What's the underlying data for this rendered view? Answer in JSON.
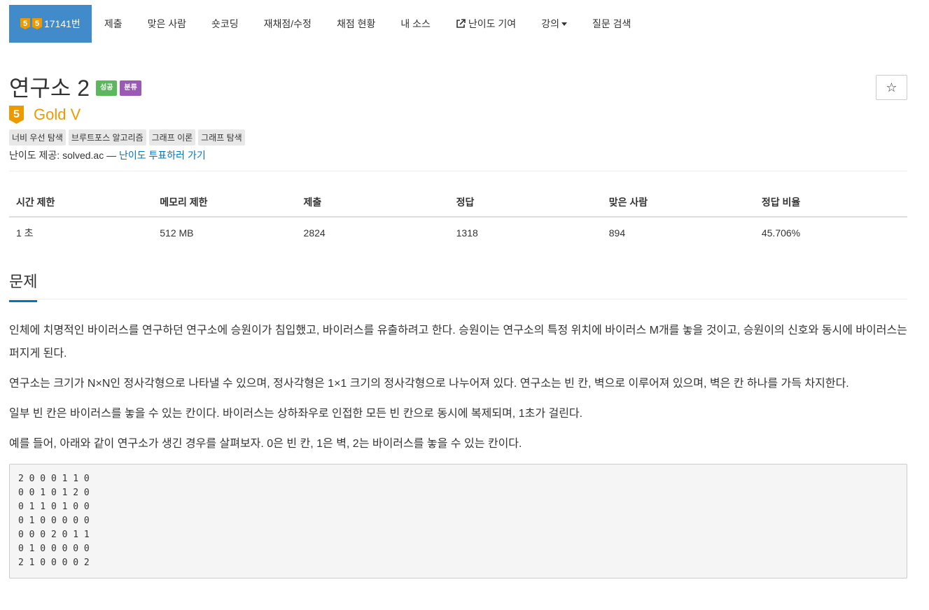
{
  "nav": {
    "problem_number": "17141번",
    "tier_digit": "5",
    "items": [
      "제출",
      "맞은 사람",
      "숏코딩",
      "재채점/수정",
      "채점 현황",
      "내 소스",
      "난이도 기여",
      "강의",
      "질문 검색"
    ]
  },
  "header": {
    "title": "연구소 2",
    "badge_success": "성공",
    "badge_category": "분류",
    "star": "☆",
    "tier_digit": "5",
    "tier_name": "Gold V",
    "tags": [
      "너비 우선 탐색",
      "브루트포스 알고리즘",
      "그래프 이론",
      "그래프 탐색"
    ],
    "provider_prefix": "난이도 제공: solved.ac — ",
    "provider_link": "난이도 투표하러 가기"
  },
  "stats": {
    "headers": [
      "시간 제한",
      "메모리 제한",
      "제출",
      "정답",
      "맞은 사람",
      "정답 비율"
    ],
    "values": [
      "1 초",
      "512 MB",
      "2824",
      "1318",
      "894",
      "45.706%"
    ]
  },
  "problem": {
    "section_title": "문제",
    "paragraphs": [
      "인체에 치명적인 바이러스를 연구하던 연구소에 승원이가 침입했고, 바이러스를 유출하려고 한다. 승원이는 연구소의 특정 위치에 바이러스 M개를 놓을 것이고, 승원이의 신호와 동시에 바이러스는 퍼지게 된다.",
      "연구소는 크기가 N×N인 정사각형으로 나타낼 수 있으며, 정사각형은 1×1 크기의 정사각형으로 나누어져 있다. 연구소는 빈 칸, 벽으로 이루어져 있으며, 벽은 칸 하나를 가득 차지한다.",
      "일부 빈 칸은 바이러스를 놓을 수 있는 칸이다. 바이러스는 상하좌우로 인접한 모든 빈 칸으로 동시에 복제되며, 1초가 걸린다.",
      "예를 들어, 아래와 같이 연구소가 생긴 경우를 살펴보자. 0은 빈 칸, 1은 벽, 2는 바이러스를 놓을 수 있는 칸이다."
    ],
    "grid": "2 0 0 0 1 1 0\n0 0 1 0 1 2 0\n0 1 1 0 1 0 0\n0 1 0 0 0 0 0\n0 0 0 2 0 1 1\n0 1 0 0 0 0 0\n2 1 0 0 0 0 2"
  },
  "colors": {
    "nav_active": "#428bca",
    "tier_gold": "#ec9a00",
    "link": "#0076c0",
    "badge_green": "#5cb85c",
    "badge_purple": "#9b59b6"
  }
}
